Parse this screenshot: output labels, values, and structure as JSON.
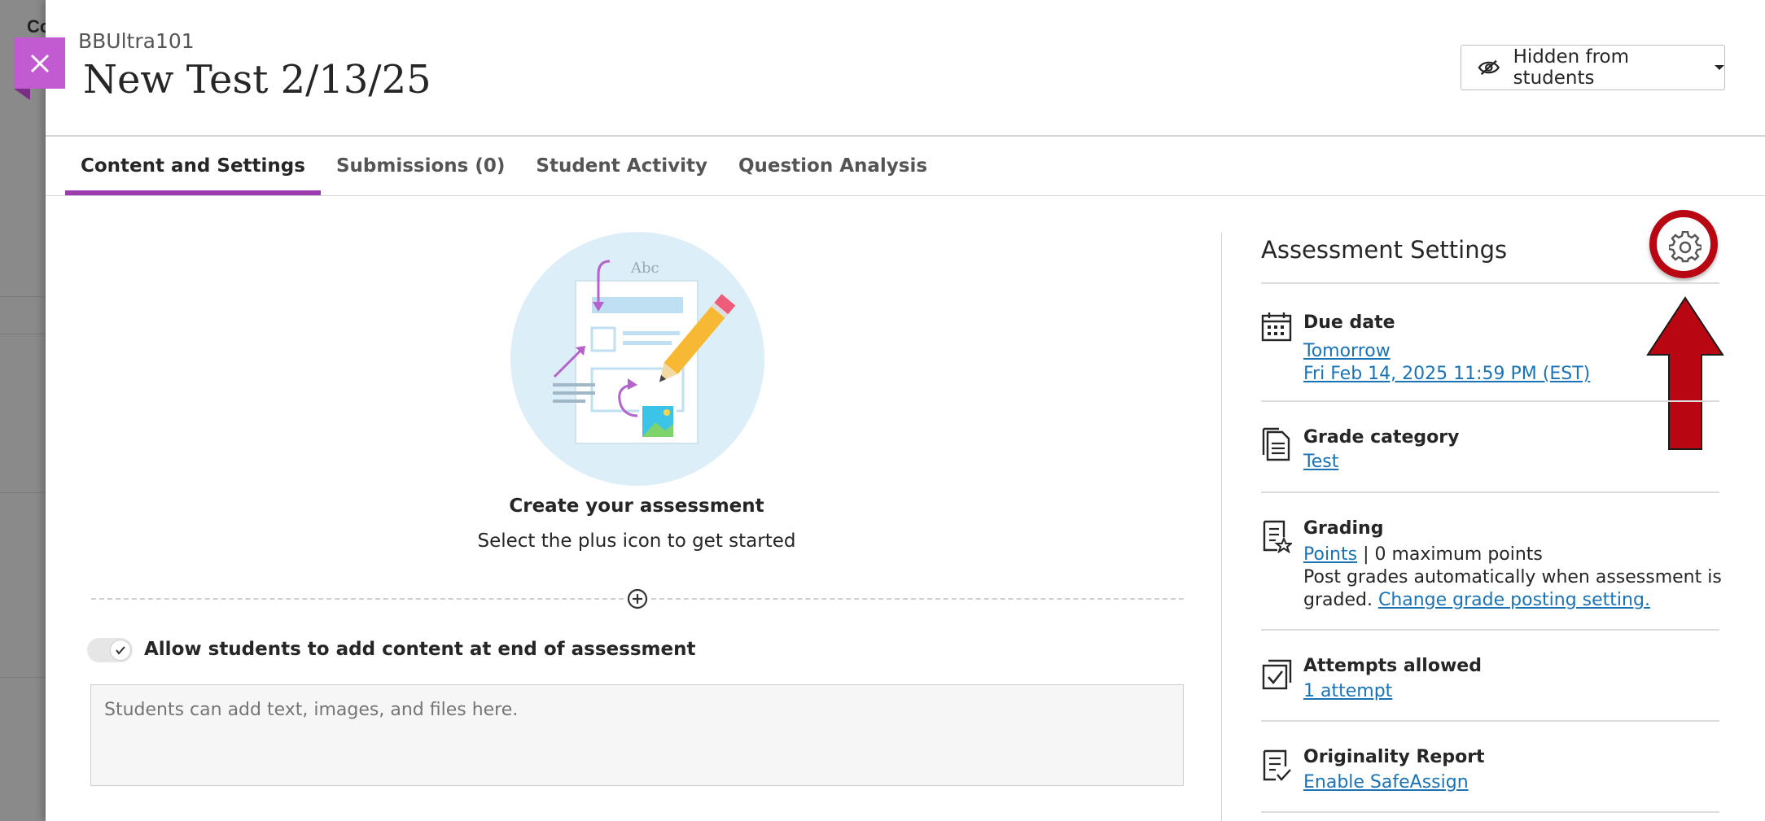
{
  "background": {
    "text": "Co"
  },
  "header": {
    "course_name": "BBUltra101",
    "title": "New Test 2/13/25",
    "visibility_label": "Hidden from students"
  },
  "tabs": [
    {
      "label": "Content and Settings",
      "active": true
    },
    {
      "label": "Submissions (0)",
      "active": false
    },
    {
      "label": "Student Activity",
      "active": false
    },
    {
      "label": "Question Analysis",
      "active": false
    }
  ],
  "content": {
    "illustration_text": "Abc",
    "create_title": "Create your assessment",
    "create_subtitle": "Select the plus icon to get started",
    "toggle_label": "Allow students to add content at end of assessment",
    "textarea_placeholder": "Students can add text, images, and files here."
  },
  "settings": {
    "title": "Assessment Settings",
    "due_date": {
      "label": "Due date",
      "relative": "Tomorrow",
      "absolute": "Fri Feb 14, 2025 11:59 PM (EST)"
    },
    "grade_category": {
      "label": "Grade category",
      "value": "Test"
    },
    "grading": {
      "label": "Grading",
      "link": "Points",
      "points_text": " | 0 maximum points",
      "line2": "Post grades automatically when assessment is",
      "line3_prefix": "graded. ",
      "line3_link": "Change grade posting setting."
    },
    "attempts": {
      "label": "Attempts allowed",
      "value": "1 attempt"
    },
    "originality": {
      "label": "Originality Report",
      "value": "Enable SafeAssign"
    }
  },
  "colors": {
    "accent_purple": "#9c3bb0",
    "close_button": "#c25ad2",
    "link_blue": "#1a73b5",
    "annotation_red": "#b80712"
  }
}
